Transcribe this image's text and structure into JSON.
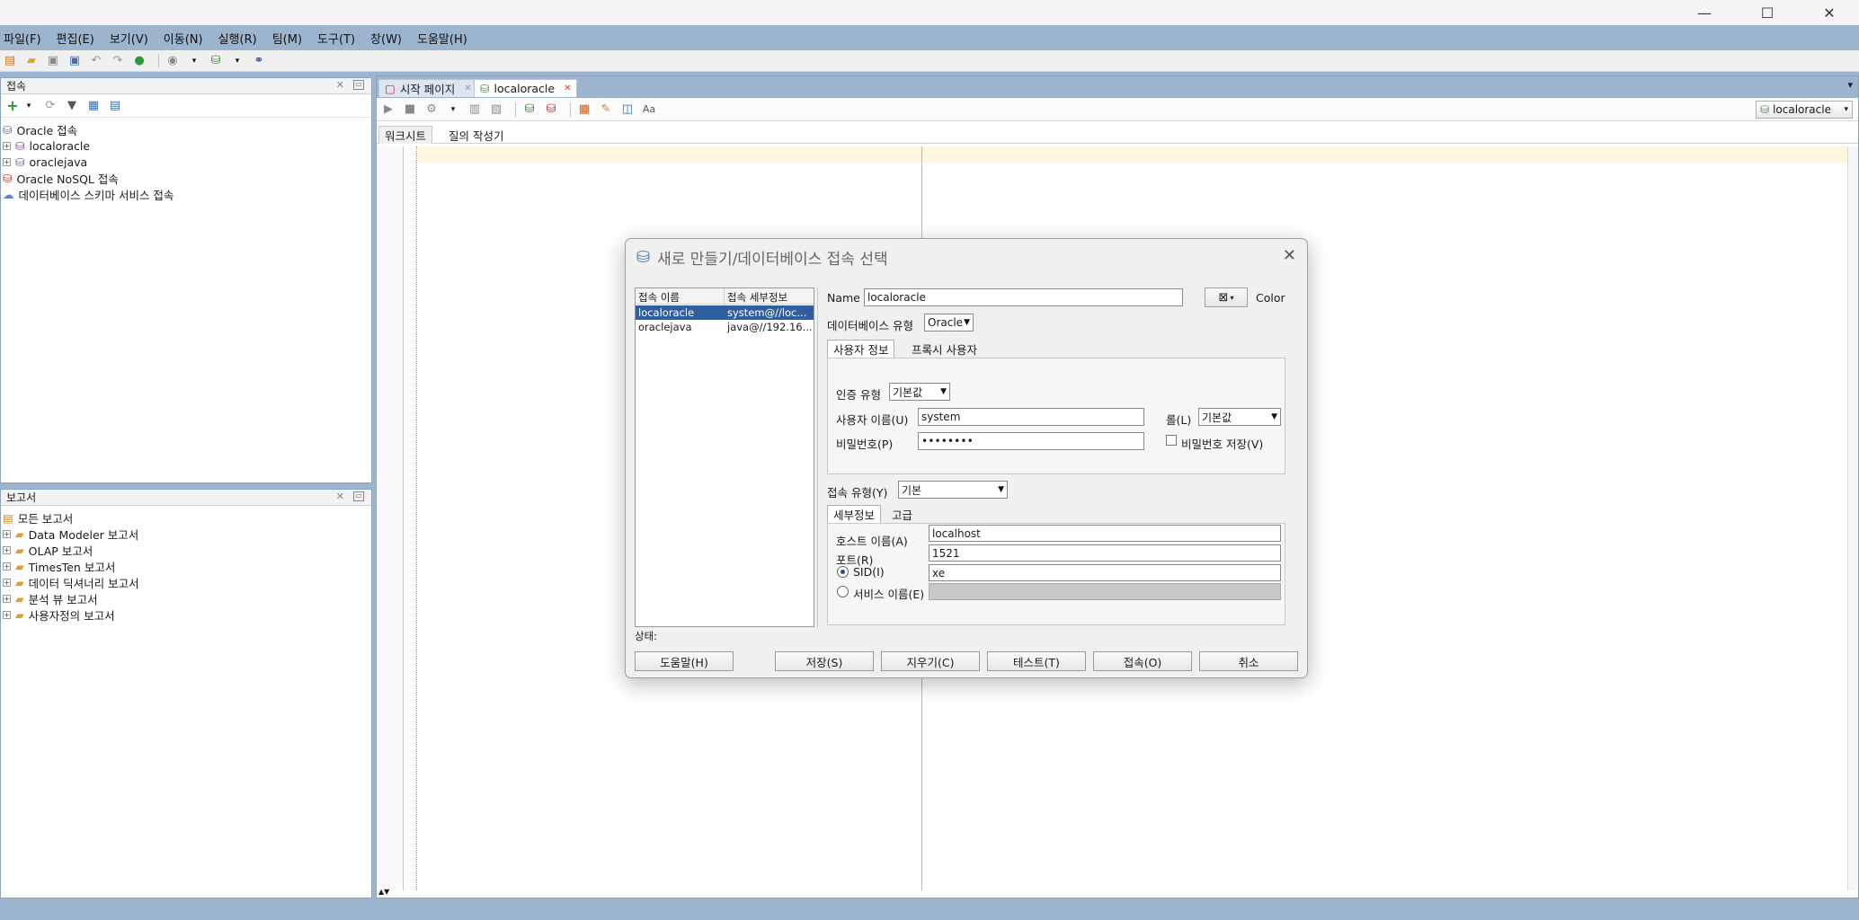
{
  "window": {
    "minimize": "—",
    "maximize": "☐",
    "close": "✕"
  },
  "menu": [
    "파일(F)",
    "편집(E)",
    "보기(V)",
    "이동(N)",
    "실행(R)",
    "팀(M)",
    "도구(T)",
    "창(W)",
    "도움말(H)"
  ],
  "connections_panel": {
    "title": "접속",
    "items": [
      "Oracle 접속",
      "localoracle",
      "oraclejava",
      "Oracle NoSQL 접속",
      "데이터베이스 스키마 서비스 접속"
    ]
  },
  "reports_panel": {
    "title": "보고서",
    "items": [
      "모든 보고서",
      "Data Modeler 보고서",
      "OLAP 보고서",
      "TimesTen 보고서",
      "데이터 딕셔너리 보고서",
      "분석 뷰 보고서",
      "사용자정의 보고서"
    ]
  },
  "editor": {
    "tabs": [
      "시작 페이지",
      "localoracle"
    ],
    "connection_selector": "localoracle",
    "subtabs": [
      "워크시트",
      "질의 작성기"
    ]
  },
  "dialog": {
    "title": "새로 만들기/데이터베이스 접속 선택",
    "list_headers": [
      "접속 이름",
      "접속 세부정보"
    ],
    "connections": [
      {
        "name": "localoracle",
        "details": "system@//loc..."
      },
      {
        "name": "oraclejava",
        "details": "java@//192.16..."
      }
    ],
    "name_label": "Name",
    "name_value": "localoracle",
    "color_label": "Color",
    "db_type_label": "데이터베이스 유형",
    "db_type_value": "Oracle",
    "user_tabs": [
      "사용자 정보",
      "프록시 사용자"
    ],
    "auth_type_label": "인증 유형",
    "auth_type_value": "기본값",
    "username_label": "사용자 이름(U)",
    "username_value": "system",
    "role_label": "롤(L)",
    "role_value": "기본값",
    "password_label": "비밀번호(P)",
    "password_value": "••••••••",
    "save_password_label": "비밀번호 저장(V)",
    "conn_type_label": "접속 유형(Y)",
    "conn_type_value": "기본",
    "detail_tabs": [
      "세부정보",
      "고급"
    ],
    "host_label": "호스트 이름(A)",
    "host_value": "localhost",
    "port_label": "포트(R)",
    "port_value": "1521",
    "sid_label": "SID(I)",
    "sid_value": "xe",
    "service_label": "서비스 이름(E)",
    "status_label": "상태:",
    "buttons": {
      "help": "도움말(H)",
      "save": "저장(S)",
      "clear": "지우기(C)",
      "test": "테스트(T)",
      "connect": "접속(O)",
      "cancel": "취소"
    }
  }
}
